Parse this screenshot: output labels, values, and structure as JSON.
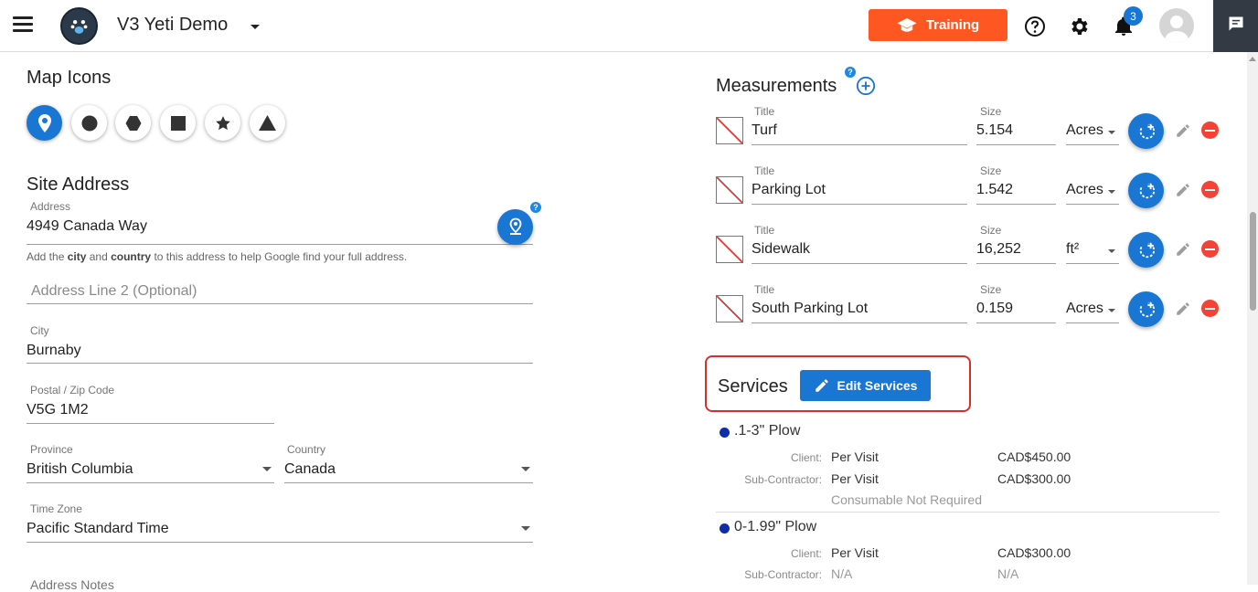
{
  "header": {
    "app_title": "V3 Yeti Demo",
    "training_label": "Training",
    "notification_count": "3"
  },
  "colors": {
    "primary": "#1976d2",
    "training": "#ff5722",
    "danger": "#f44336",
    "highlight_border": "#d32f2f",
    "sidebar_dark": "#333a44"
  },
  "map_icons": {
    "title": "Map Icons",
    "icons": [
      "map-pin-icon",
      "circle-icon",
      "hexagon-icon",
      "square-icon",
      "star-icon",
      "triangle-icon"
    ],
    "selected": "map-pin-icon"
  },
  "site_address": {
    "title": "Site Address",
    "address_label": "Address",
    "address_value": "4949 Canada Way",
    "hint_prefix": "Add the ",
    "hint_city": "city",
    "hint_mid": " and ",
    "hint_country": "country",
    "hint_suffix": " to this address to help Google find your full address.",
    "address2_placeholder": "Address Line 2 (Optional)",
    "city_label": "City",
    "city_value": "Burnaby",
    "postal_label": "Postal / Zip Code",
    "postal_value": "V5G 1M2",
    "province_label": "Province",
    "province_value": "British Columbia",
    "country_label": "Country",
    "country_value": "Canada",
    "timezone_label": "Time Zone",
    "timezone_value": "Pacific Standard Time",
    "next_label_partial": "Address Notes"
  },
  "measurements": {
    "title": "Measurements",
    "title_label": "Title",
    "size_label": "Size",
    "rows": [
      {
        "title": "Turf",
        "size": "5.154",
        "unit": "Acres"
      },
      {
        "title": "Parking Lot",
        "size": "1.542",
        "unit": "Acres"
      },
      {
        "title": "Sidewalk",
        "size": "16,252",
        "unit": "ft²"
      },
      {
        "title": "South Parking Lot",
        "size": "0.159",
        "unit": "Acres"
      }
    ]
  },
  "services": {
    "title": "Services",
    "edit_label": "Edit Services",
    "client_label": "Client:",
    "sub_label": "Sub-Contractor:",
    "items": [
      {
        "name": ".1-3\" Plow",
        "client_type": "Per Visit",
        "client_price": "CAD$450.00",
        "sub_type": "Per Visit",
        "sub_price": "CAD$300.00",
        "note": "Consumable Not Required"
      },
      {
        "name": "0-1.99\" Plow",
        "client_type": "Per Visit",
        "client_price": "CAD$300.00",
        "sub_type": "N/A",
        "sub_price": "N/A"
      }
    ]
  }
}
